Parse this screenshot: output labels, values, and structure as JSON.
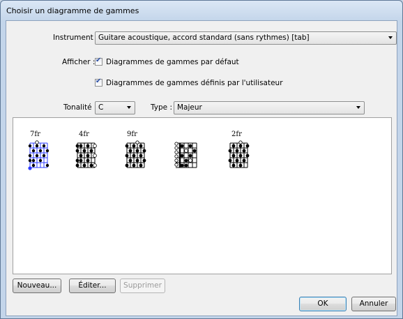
{
  "window": {
    "title": "Choisir un diagramme de gammes"
  },
  "form": {
    "instrument_label": "Instrument :",
    "instrument_value": "Guitare acoustique, accord standard (sans rythmes) [tab]",
    "show_label": "Afficher :",
    "checkbox_default_label": "Diagrammes de gammes par défaut",
    "checkbox_default_checked": true,
    "checkbox_user_label": "Diagrammes de gammes définis par l'utilisateur",
    "checkbox_user_checked": true,
    "key_label": "Tonalité :",
    "key_value": "C",
    "type_label": "Type :",
    "type_value": "Majeur"
  },
  "diagrams": [
    {
      "fret_label": "7fr",
      "selected": true
    },
    {
      "fret_label": "4fr",
      "selected": false
    },
    {
      "fret_label": "9fr",
      "selected": false
    },
    {
      "fret_label": "",
      "selected": false
    },
    {
      "fret_label": "2fr",
      "selected": false
    }
  ],
  "buttons": {
    "new": "Nouveau...",
    "edit": "Éditer...",
    "delete": "Supprimer",
    "ok": "OK",
    "cancel": "Annuler"
  }
}
